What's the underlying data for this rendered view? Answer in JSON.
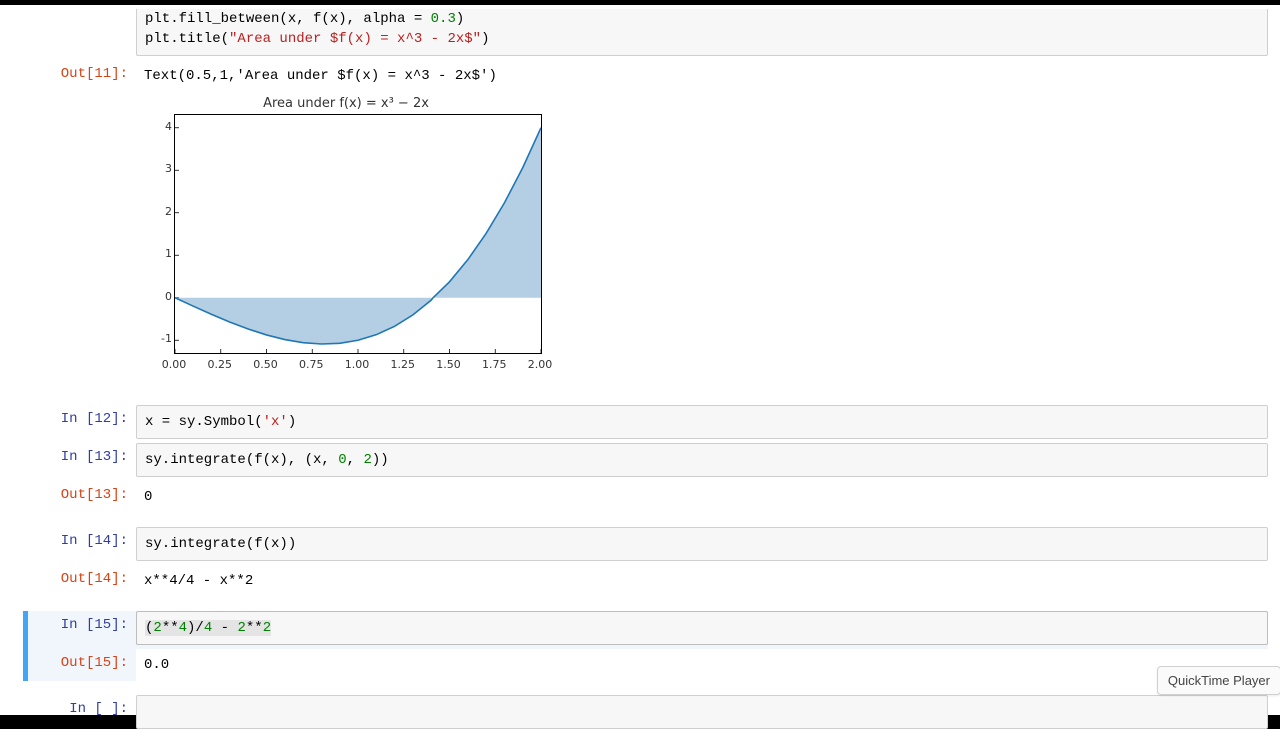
{
  "colors": {
    "accent_blue": "#42A5F5",
    "string": "#BA2121",
    "number": "#008000",
    "in_prompt": "#303F9F",
    "out_prompt": "#D84315",
    "fill": "#a7c6df",
    "line": "#1f77b4"
  },
  "qt_label": "QuickTime Player",
  "cells": {
    "top_partial": {
      "in_number": 11,
      "code_lines": [
        {
          "raw": "plt.fill_between(x, f(x), alpha = 0.3)",
          "segments": [
            {
              "t": "plt.fill_between(x, f(x), alpha = "
            },
            {
              "t": "0.3",
              "cls": "n"
            },
            {
              "t": ")"
            }
          ]
        },
        {
          "raw": "plt.title(\"Area under $f(x) = x^3 - 2x$\")",
          "segments": [
            {
              "t": "plt.title("
            },
            {
              "t": "\"Area under $f(x) = x^3 - 2x$\"",
              "cls": "s"
            },
            {
              "t": ")"
            }
          ]
        }
      ],
      "out_prompt": "Out[11]:",
      "out_text": "Text(0.5,1,'Area under $f(x) = x^3 - 2x$')"
    },
    "c12": {
      "in_prompt": "In [12]:",
      "segments": [
        {
          "t": "x = sy.Symbol("
        },
        {
          "t": "'x'",
          "cls": "s"
        },
        {
          "t": ")"
        }
      ]
    },
    "c13": {
      "in_prompt": "In [13]:",
      "segments": [
        {
          "t": "sy.integrate(f(x), (x, "
        },
        {
          "t": "0",
          "cls": "n"
        },
        {
          "t": ", "
        },
        {
          "t": "2",
          "cls": "n"
        },
        {
          "t": "))"
        }
      ],
      "out_prompt": "Out[13]:",
      "out_text": "0"
    },
    "c14": {
      "in_prompt": "In [14]:",
      "segments": [
        {
          "t": "sy.integrate(f(x))"
        }
      ],
      "out_prompt": "Out[14]:",
      "out_text": "x**4/4 - x**2"
    },
    "c15": {
      "in_prompt": "In [15]:",
      "segments": [
        {
          "t": "(",
          "cls": "hl"
        },
        {
          "t": "2",
          "cls": "n hl"
        },
        {
          "t": "**",
          "cls": "hl"
        },
        {
          "t": "4",
          "cls": "n hl"
        },
        {
          "t": ")/",
          "cls": "hl"
        },
        {
          "t": "4",
          "cls": "n hl"
        },
        {
          "t": " - ",
          "cls": "hl"
        },
        {
          "t": "2",
          "cls": "n hl"
        },
        {
          "t": "**",
          "cls": "hl"
        },
        {
          "t": "2",
          "cls": "n hl"
        }
      ],
      "out_prompt": "Out[15]:",
      "out_text": "0.0"
    },
    "c_empty": {
      "in_prompt": "In [ ]:"
    }
  },
  "chart_data": {
    "type": "area",
    "title": "Area under f(x) = x³ − 2x",
    "xlabel": "",
    "ylabel": "",
    "xlim": [
      0,
      2
    ],
    "ylim": [
      -1.3,
      4.3
    ],
    "xticks": [
      "0.00",
      "0.25",
      "0.50",
      "0.75",
      "1.00",
      "1.25",
      "1.50",
      "1.75",
      "2.00"
    ],
    "yticks": [
      -1,
      0,
      1,
      2,
      3,
      4
    ],
    "series": [
      {
        "name": "f(x) = x^3 - 2x",
        "x": [
          0.0,
          0.1,
          0.2,
          0.3,
          0.4,
          0.5,
          0.6,
          0.7,
          0.8,
          0.9,
          1.0,
          1.1,
          1.2,
          1.3,
          1.4,
          1.41,
          1.5,
          1.6,
          1.7,
          1.8,
          1.9,
          2.0
        ],
        "y": [
          0.0,
          -0.199,
          -0.392,
          -0.573,
          -0.736,
          -0.875,
          -0.984,
          -1.057,
          -1.088,
          -1.071,
          -1.0,
          -0.869,
          -0.672,
          -0.403,
          -0.056,
          0.0,
          0.375,
          0.896,
          1.513,
          2.232,
          3.059,
          4.0
        ]
      }
    ],
    "fill_to": 0,
    "fill_alpha": 0.3
  }
}
